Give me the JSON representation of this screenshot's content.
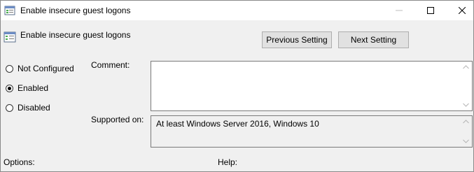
{
  "window": {
    "title": "Enable insecure guest logons",
    "controls": [
      "minimize-icon",
      "maximize-icon",
      "close-icon"
    ]
  },
  "policy": {
    "name": "Enable insecure guest logons"
  },
  "nav": {
    "previous_label": "Previous Setting",
    "next_label": "Next Setting"
  },
  "state": {
    "options": [
      {
        "label": "Not Configured",
        "selected": false
      },
      {
        "label": "Enabled",
        "selected": true
      },
      {
        "label": "Disabled",
        "selected": false
      }
    ]
  },
  "comment": {
    "label": "Comment:",
    "value": ""
  },
  "supported": {
    "label": "Supported on:",
    "value": "At least Windows Server 2016, Windows 10"
  },
  "sections": {
    "options_label": "Options:",
    "help_label": "Help:"
  },
  "colors": {
    "window_bg": "#f0f0f0",
    "titlebar_bg": "#ffffff",
    "button_bg": "#e1e1e1"
  }
}
